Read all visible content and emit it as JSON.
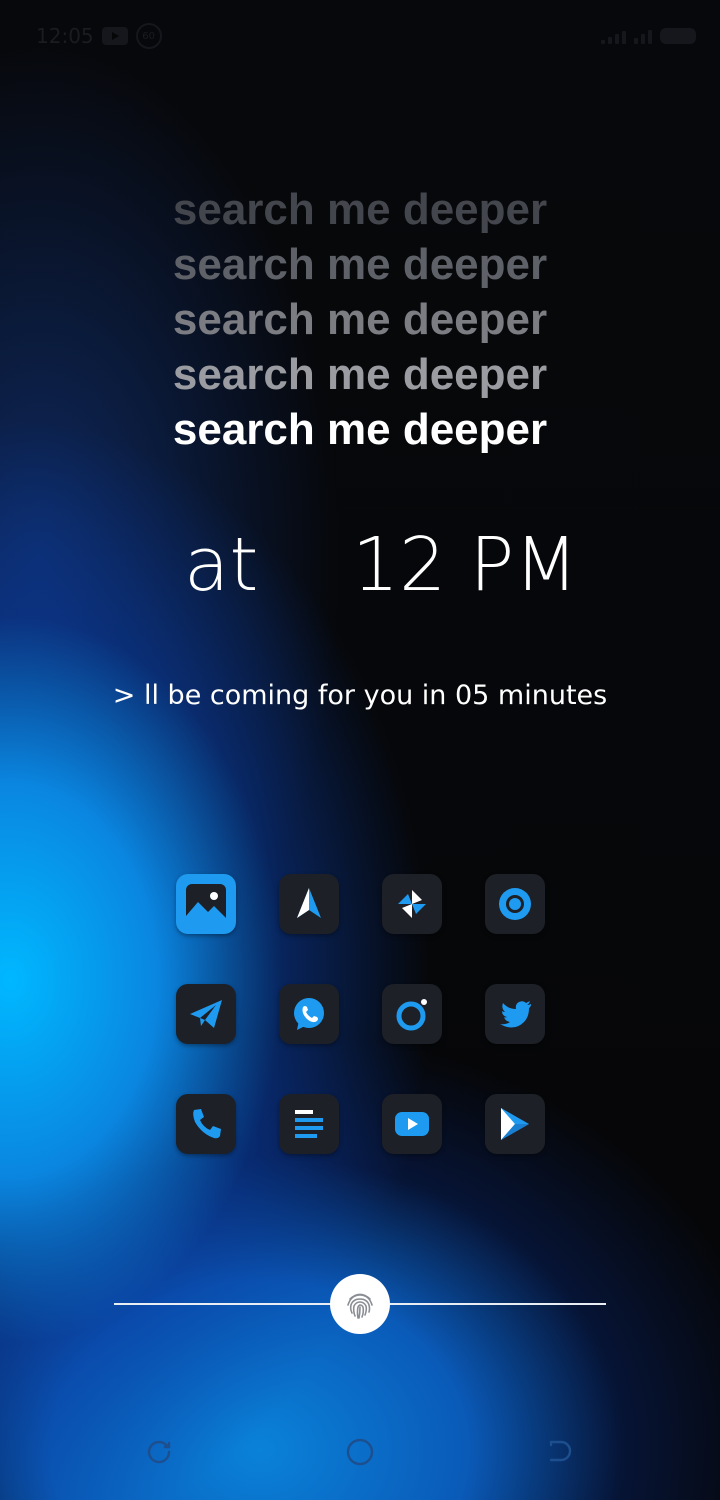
{
  "status_bar": {
    "time": "12:05",
    "icons": [
      "youtube-icon",
      "badge-60-icon"
    ],
    "badge_text": "60",
    "right_icons": [
      "signal-icon",
      "wifi-icon",
      "battery-icon"
    ]
  },
  "phrases": [
    "search me deeper",
    "search me deeper",
    "search me deeper",
    "search me deeper",
    "search me deeper"
  ],
  "time_display": {
    "at_label": "at",
    "clock": "12 PM"
  },
  "subtitle": "> ll be coming for you in 05 minutes",
  "apps": [
    {
      "icon": "gallery-icon"
    },
    {
      "icon": "spark-mail-icon"
    },
    {
      "icon": "pinwheel-icon"
    },
    {
      "icon": "chrome-icon"
    },
    {
      "icon": "telegram-icon"
    },
    {
      "icon": "whatsapp-icon"
    },
    {
      "icon": "camera-icon"
    },
    {
      "icon": "twitter-icon"
    },
    {
      "icon": "phone-icon"
    },
    {
      "icon": "notes-icon"
    },
    {
      "icon": "youtube-icon"
    },
    {
      "icon": "play-store-icon"
    }
  ],
  "unlock": {
    "icon": "fingerprint-icon"
  },
  "navigation": [
    "recents-icon",
    "home-icon",
    "back-icon"
  ],
  "colors": {
    "accent": "#1e9bf0",
    "icon_bg": "#1d2026"
  }
}
